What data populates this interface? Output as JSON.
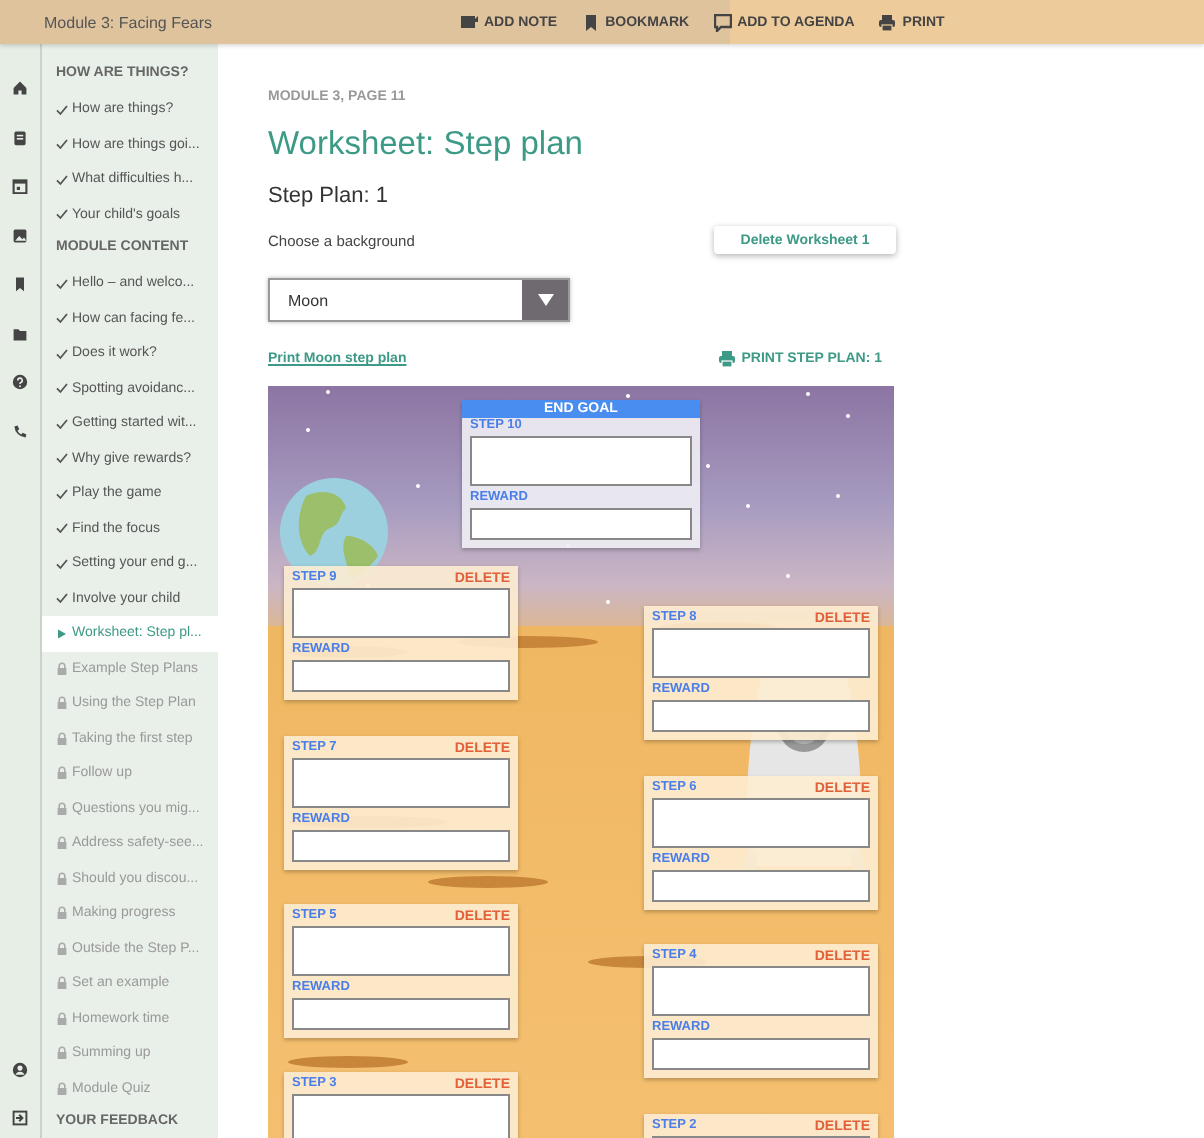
{
  "top_bar": {
    "title": "Module 3: Facing Fears",
    "actions": [
      {
        "label": "ADD NOTE"
      },
      {
        "label": "BOOKMARK"
      },
      {
        "label": "ADD TO AGENDA"
      },
      {
        "label": "PRINT"
      }
    ]
  },
  "nav": {
    "sections": [
      {
        "heading": "HOW ARE THINGS?",
        "items": [
          {
            "label": "How are things?",
            "kind": "done",
            "selected": false
          },
          {
            "label": "How are things goi...",
            "kind": "done",
            "selected": false
          },
          {
            "label": "What difficulties h...",
            "kind": "done",
            "selected": false
          },
          {
            "label": "Your child's goals",
            "kind": "done",
            "selected": false
          }
        ]
      },
      {
        "heading": "MODULE CONTENT",
        "items": [
          {
            "label": "Hello – and welco...",
            "kind": "done",
            "selected": false
          },
          {
            "label": "How can facing fe...",
            "kind": "done",
            "selected": false
          },
          {
            "label": "Does it work?",
            "kind": "done",
            "selected": false
          },
          {
            "label": "Spotting avoidanc...",
            "kind": "done",
            "selected": false
          },
          {
            "label": "Getting started wit...",
            "kind": "done",
            "selected": false
          },
          {
            "label": "Why give rewards?",
            "kind": "done",
            "selected": false
          },
          {
            "label": "Play the game",
            "kind": "done",
            "selected": false
          },
          {
            "label": "Find the focus",
            "kind": "done",
            "selected": false
          },
          {
            "label": "Setting your end g...",
            "kind": "done",
            "selected": false
          },
          {
            "label": "Involve your child",
            "kind": "done",
            "selected": false
          },
          {
            "label": "Worksheet: Step pl...",
            "kind": "current",
            "selected": true
          },
          {
            "label": "Example Step Plans",
            "kind": "locked",
            "selected": false
          },
          {
            "label": "Using the Step Plan",
            "kind": "locked",
            "selected": false
          },
          {
            "label": "Taking the first step",
            "kind": "locked",
            "selected": false
          },
          {
            "label": "Follow up",
            "kind": "locked",
            "selected": false
          },
          {
            "label": "Questions you mig...",
            "kind": "locked",
            "selected": false
          },
          {
            "label": "Address safety-see...",
            "kind": "locked",
            "selected": false
          },
          {
            "label": "Should you discou...",
            "kind": "locked",
            "selected": false
          },
          {
            "label": "Making progress",
            "kind": "locked",
            "selected": false
          },
          {
            "label": "Outside the Step P...",
            "kind": "locked",
            "selected": false
          },
          {
            "label": "Set an example",
            "kind": "locked",
            "selected": false
          },
          {
            "label": "Homework time",
            "kind": "locked",
            "selected": false
          },
          {
            "label": "Summing up",
            "kind": "locked",
            "selected": false
          },
          {
            "label": "Module Quiz",
            "kind": "locked",
            "selected": false
          }
        ]
      },
      {
        "heading": "YOUR FEEDBACK"
      }
    ]
  },
  "main": {
    "breadcrumb": "MODULE 3, PAGE 11",
    "title": "Worksheet: Step plan",
    "subtitle": "Step Plan: 1",
    "background_label": "Choose a background",
    "delete_button": "Delete Worksheet 1",
    "background_select": {
      "value": "Moon"
    },
    "print_link": "Print Moon step plan",
    "print_button": "PRINT STEP PLAN: 1"
  },
  "worksheet": {
    "cards": [
      {
        "kind": "goal",
        "title": "END GOAL",
        "label": "STEP 10",
        "reward_label": "REWARD"
      },
      {
        "kind": "step",
        "label": "STEP 9",
        "delete": "DELETE",
        "reward_label": "REWARD"
      },
      {
        "kind": "step",
        "label": "STEP 8",
        "delete": "DELETE",
        "reward_label": "REWARD"
      },
      {
        "kind": "step",
        "label": "STEP 7",
        "delete": "DELETE",
        "reward_label": "REWARD"
      },
      {
        "kind": "step",
        "label": "STEP 6",
        "delete": "DELETE",
        "reward_label": "REWARD"
      },
      {
        "kind": "step",
        "label": "STEP 5",
        "delete": "DELETE",
        "reward_label": "REWARD"
      },
      {
        "kind": "step",
        "label": "STEP 4",
        "delete": "DELETE",
        "reward_label": "REWARD"
      },
      {
        "kind": "step",
        "label": "STEP 3",
        "delete": "DELETE"
      },
      {
        "kind": "step",
        "label": "STEP 2",
        "delete": "DELETE"
      }
    ]
  }
}
